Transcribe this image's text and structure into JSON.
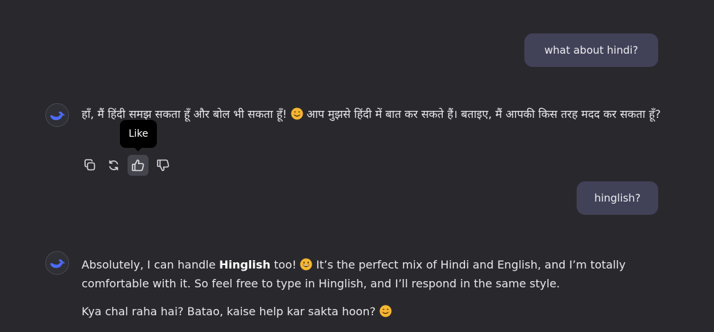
{
  "conversation": {
    "user_messages": [
      {
        "text": "what about hindi?"
      },
      {
        "text": "hinglish?"
      }
    ],
    "assistant_messages": [
      {
        "text_part1": "हाँ, मैं हिंदी समझ सकता हूँ और बोल भी सकता हूँ!",
        "text_part2": "आप मुझसे हिंदी में बात कर सकते हैं। बताइए, मैं आपकी किस तरह मदद कर सकता हूँ?"
      },
      {
        "p1_pre": "Absolutely, I can handle ",
        "p1_bold": "Hinglish",
        "p1_mid": " too!",
        "p1_post": "It’s the perfect mix of Hindi and English, and I’m totally comfortable with it. So feel free to type in Hinglish, and I’ll respond in the same style.",
        "p2": "Kya chal raha hai? Batao, kaise help kar sakta hoon?"
      }
    ]
  },
  "actions": {
    "tooltip": "Like",
    "icons": [
      "copy-icon",
      "regenerate-icon",
      "thumbs-up-icon",
      "thumbs-down-icon"
    ]
  },
  "colors": {
    "background": "#29282d",
    "user_bubble": "#414158",
    "avatar_accent": "#4d6bfe",
    "emoji": "#f5b731"
  }
}
